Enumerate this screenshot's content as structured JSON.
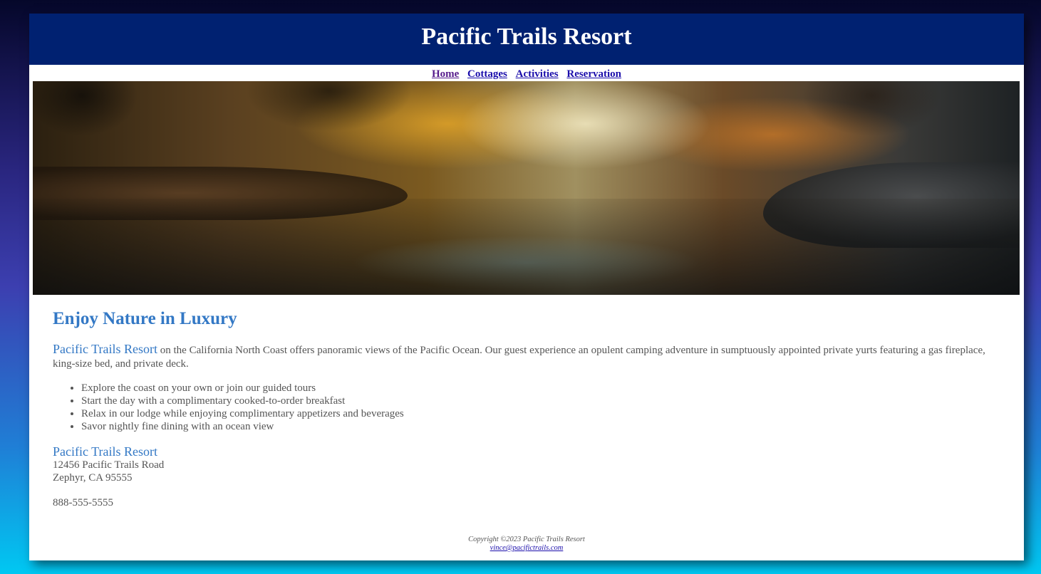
{
  "header": {
    "title": "Pacific Trails Resort"
  },
  "nav": {
    "items": [
      {
        "label": "Home"
      },
      {
        "label": "Cottages"
      },
      {
        "label": "Activities"
      },
      {
        "label": "Reservation"
      }
    ]
  },
  "hero": {
    "alt": "Misty autumn forest river reflection"
  },
  "main": {
    "heading": "Enjoy Nature in Luxury",
    "intro_brand": "Pacific Trails Resort",
    "intro_text": " on the California North Coast offers panoramic views of the Pacific Ocean. Our guest experience an opulent camping adventure in sumptuously appointed private yurts featuring a gas fireplace, king-size bed, and private deck.",
    "features": [
      "Explore the coast on your own or join our guided tours",
      "Start the day with a complimentary cooked-to-order breakfast",
      "Relax in our lodge while enjoying complimentary appetizers and beverages",
      "Savor nightly fine dining with an ocean view"
    ],
    "address": {
      "name": "Pacific Trails Resort",
      "street": "12456 Pacific Trails Road",
      "city": "Zephyr, CA 95555"
    },
    "phone": "888-555-5555"
  },
  "footer": {
    "copyright": "Copyright ©2023 Pacific Trails Resort",
    "email": "vince@pacifictrails.com"
  },
  "colors": {
    "header_bg": "#002171",
    "accent": "#3378c5",
    "text": "#555555",
    "link": "#1a0dab"
  }
}
